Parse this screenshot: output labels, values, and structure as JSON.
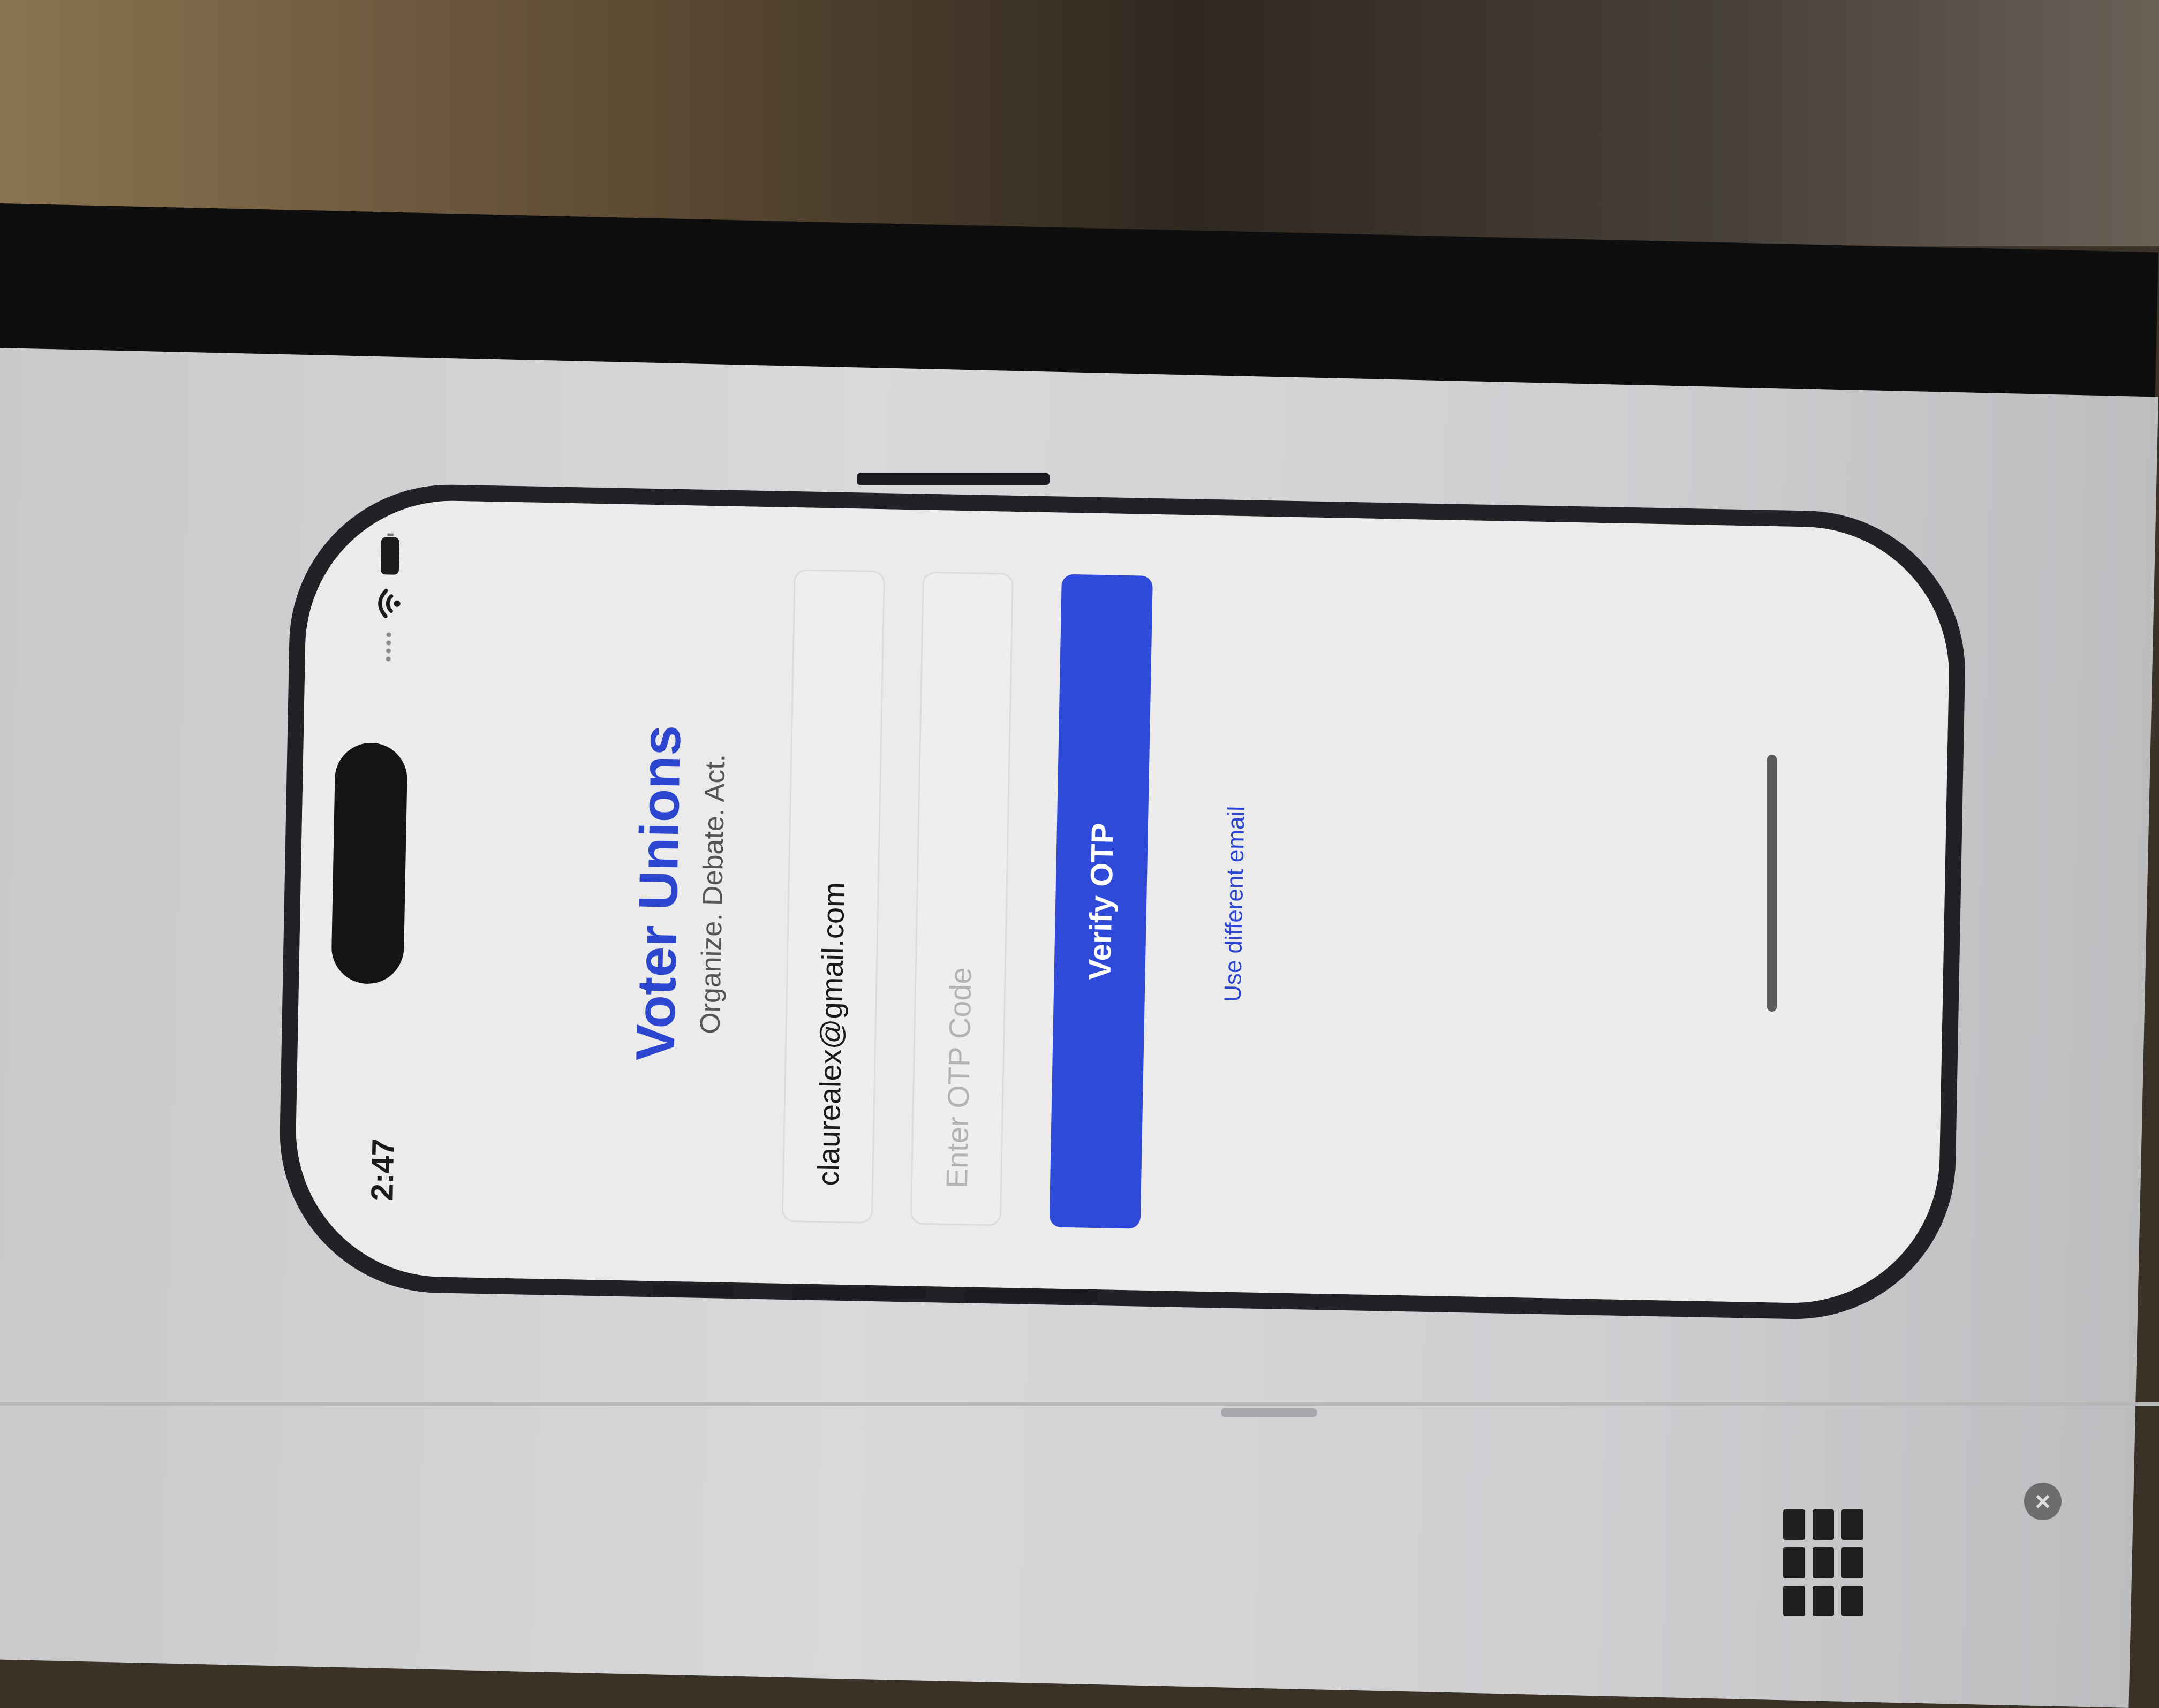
{
  "status_bar": {
    "time": "2:47"
  },
  "app": {
    "title": "Voter Unions",
    "tagline": "Organize. Debate. Act.",
    "email_field": {
      "value": "claurealex@gmail.com",
      "placeholder": ""
    },
    "otp_field": {
      "value": "",
      "placeholder": "Enter OTP Code"
    },
    "verify_button": "Verify OTP",
    "different_email_link": "Use different email"
  },
  "colors": {
    "brand_blue": "#2f4ad8",
    "screen_background": "#ebebeb"
  },
  "icons": {
    "wifi": "wifi-icon",
    "battery": "battery-icon",
    "signal": "signal-dots-icon",
    "close": "close-icon",
    "keyboard": "keyboard-icon"
  }
}
